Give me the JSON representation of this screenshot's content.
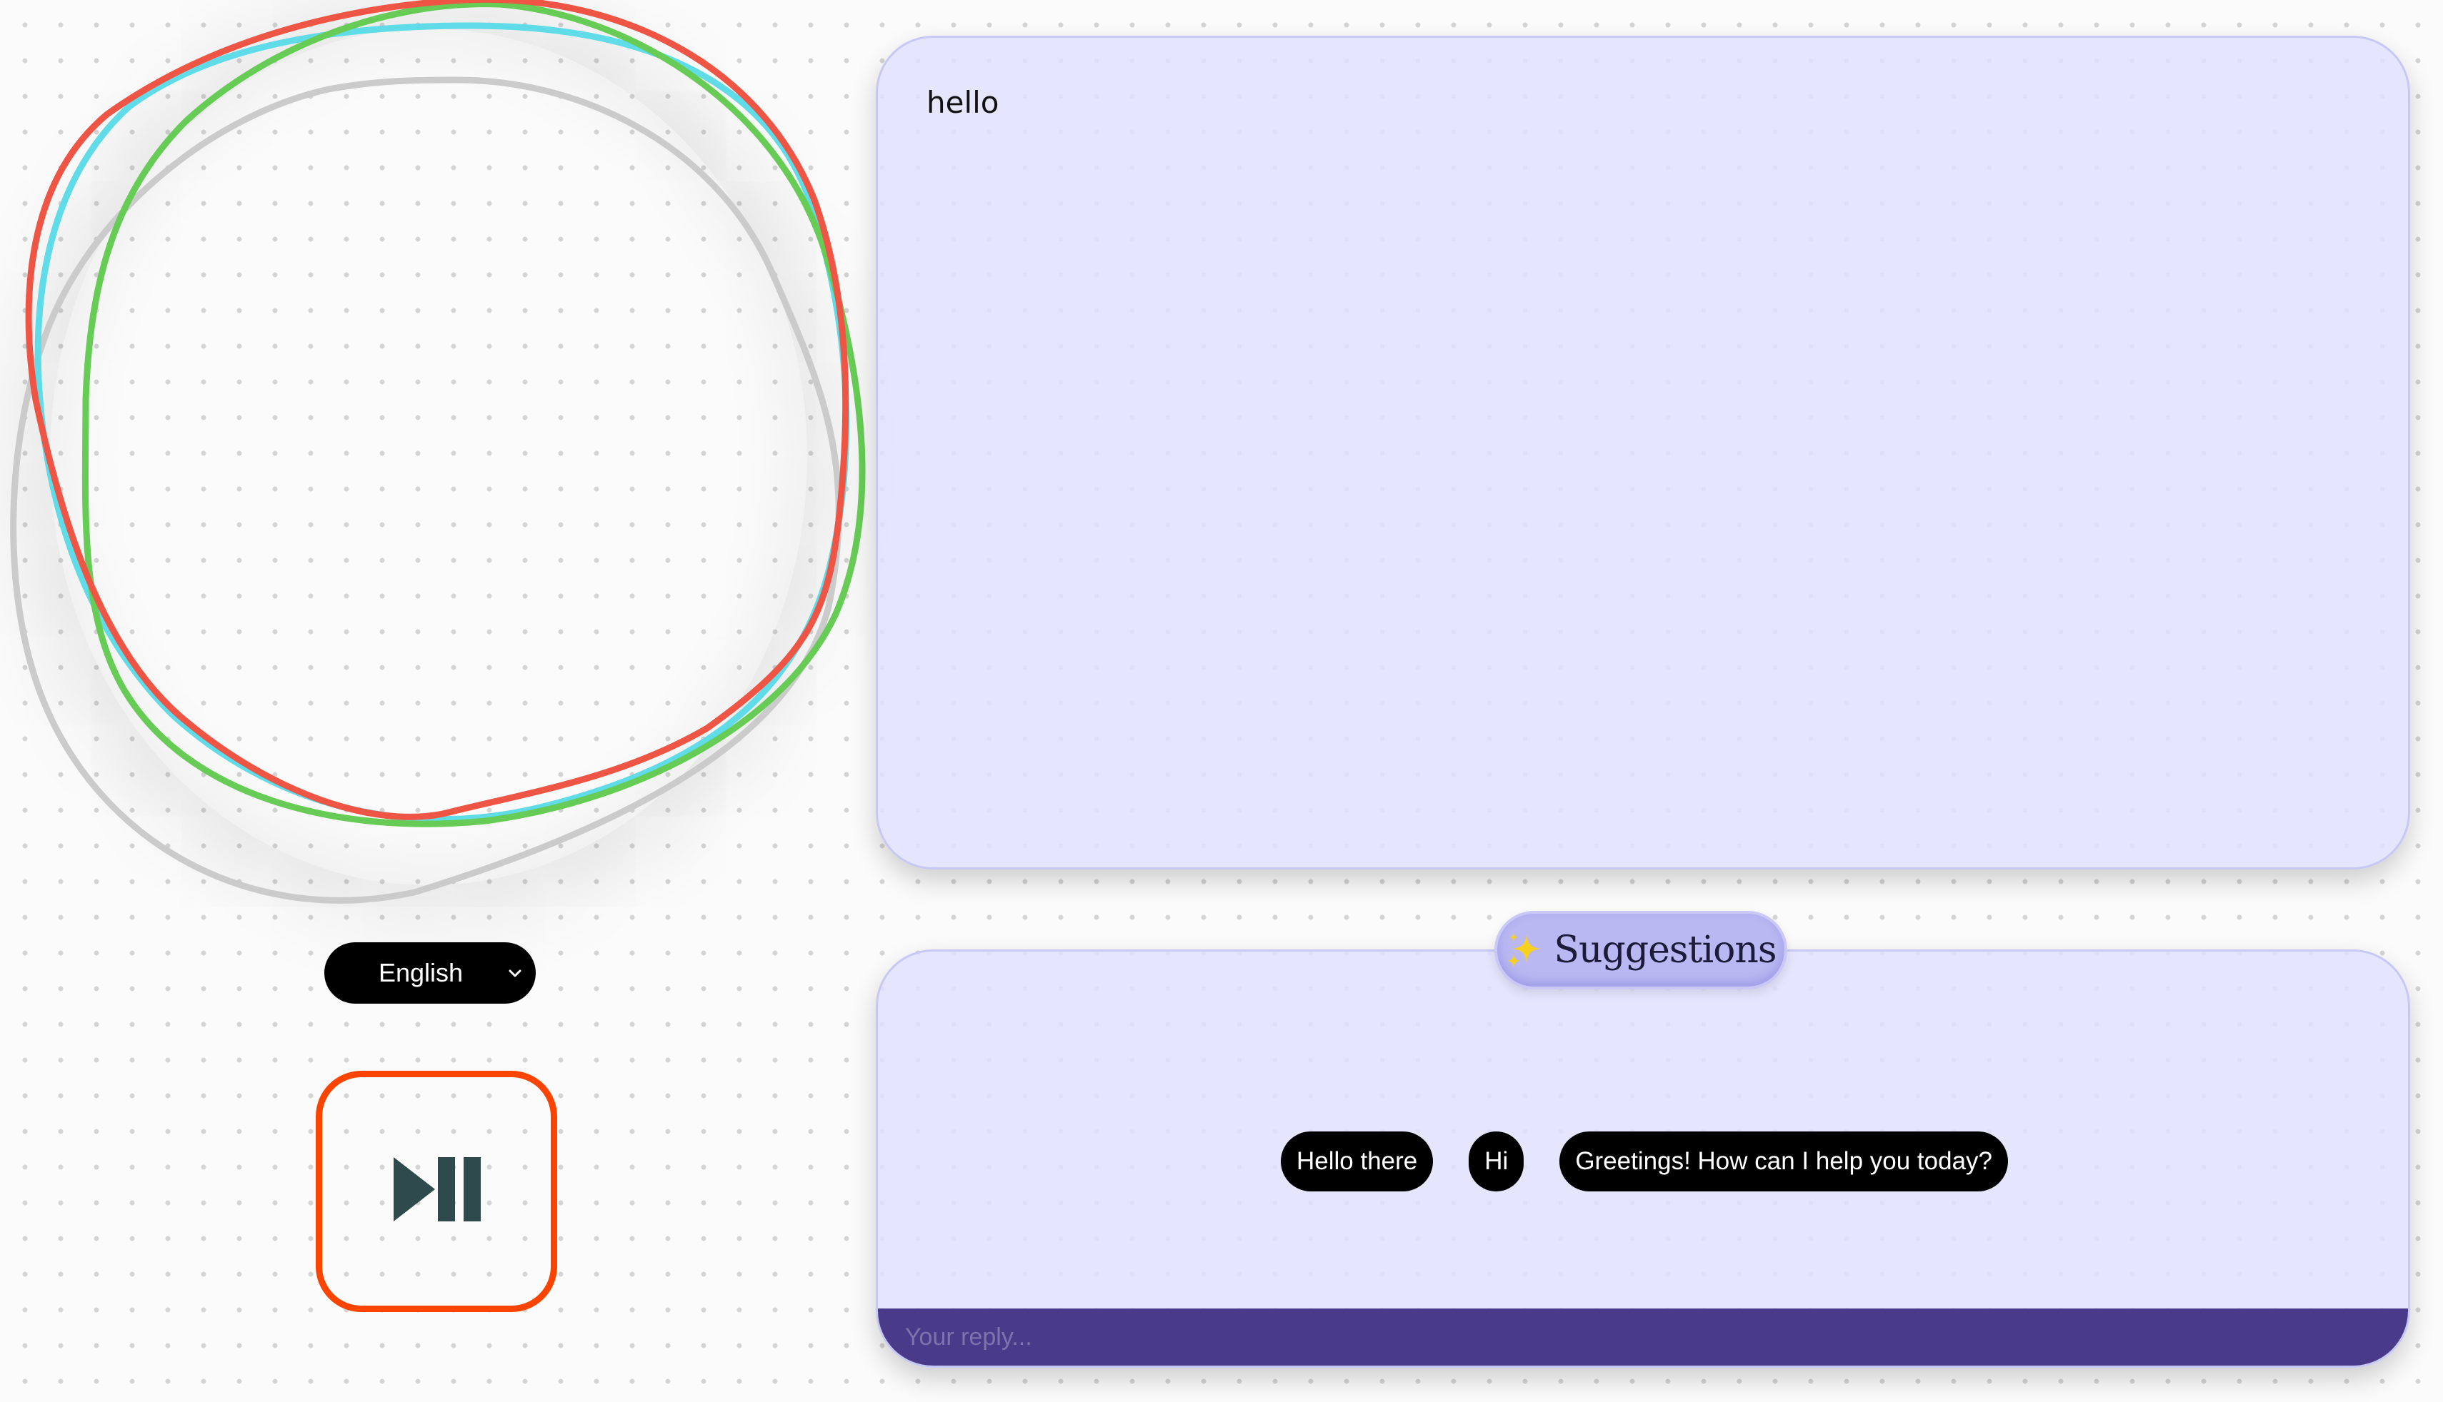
{
  "visualizer": {
    "ring_colors": [
      "#c9c9c9",
      "#60dbe8",
      "#66cc55",
      "#ee5544"
    ]
  },
  "language": {
    "selected": "English"
  },
  "player": {
    "icon": "play-pause-icon",
    "icon_color": "#2e4a4c",
    "border_color": "#fa4400"
  },
  "transcript": {
    "messages": [
      "hello"
    ]
  },
  "suggestions": {
    "title": "Suggestions",
    "title_icon": "sparkles-icon",
    "chips": [
      "Hello there",
      "Hi",
      "Greetings! How can I help you today?"
    ]
  },
  "reply": {
    "placeholder": "Your reply..."
  },
  "colors": {
    "panel_bg": "#e0e0fd",
    "reply_bar": "#493a8a",
    "chip_bg": "#000000"
  }
}
